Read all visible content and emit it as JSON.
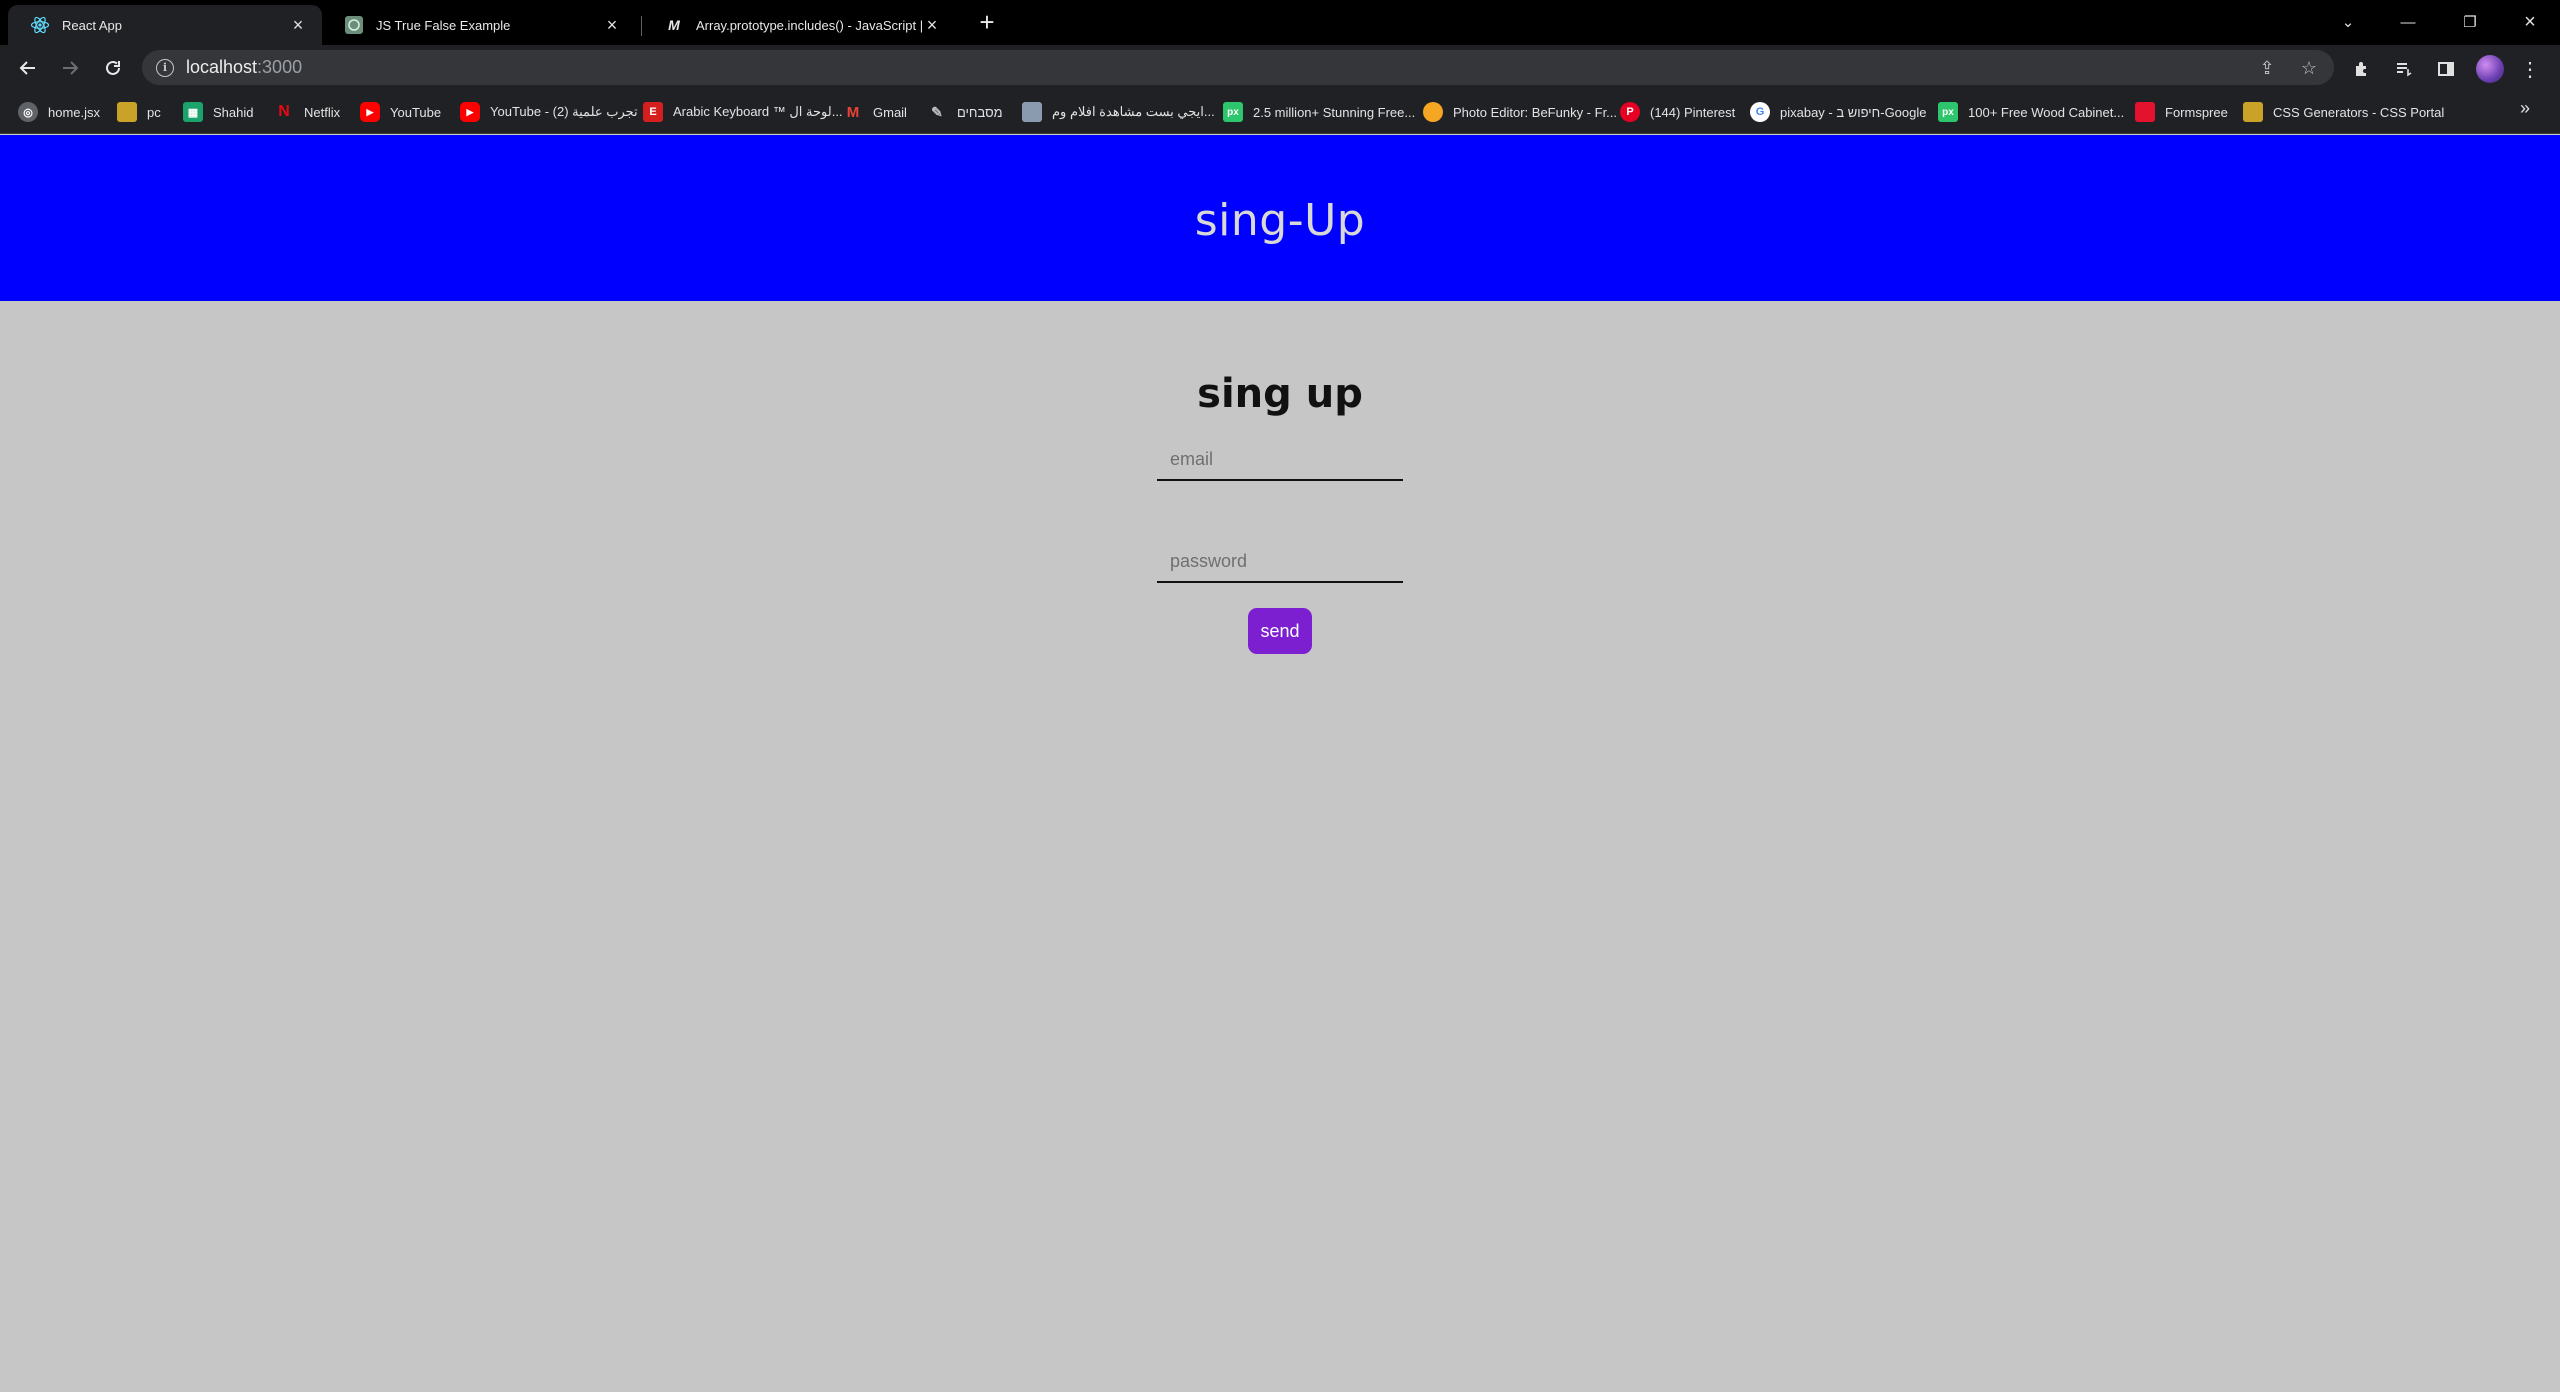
{
  "browser": {
    "tabs": [
      {
        "title": "React App",
        "icon": "react-icon",
        "active": true
      },
      {
        "title": "JS True False Example",
        "icon": "codepen-icon",
        "active": false
      },
      {
        "title": "Array.prototype.includes() - JavaScript | MDN",
        "icon": "mdn-icon",
        "active": false
      }
    ],
    "address": {
      "host": "localhost",
      "port": ":3000"
    },
    "bookmarks": [
      {
        "label": "home.jsx",
        "icon": "globe-icon",
        "color": "#5f6368"
      },
      {
        "label": "pc",
        "icon": "folder-icon",
        "color": "#c9a227"
      },
      {
        "label": "Shahid",
        "icon": "shahid-icon",
        "color": "#1aa36b"
      },
      {
        "label": "Netflix",
        "icon": "netflix-icon",
        "color": "#e50914"
      },
      {
        "label": "YouTube",
        "icon": "youtube-icon",
        "color": "#ff0000"
      },
      {
        "label": "YouTube - تجرب علمية (2)",
        "icon": "youtube-icon",
        "color": "#ff0000"
      },
      {
        "label": "Arabic Keyboard ™ لوحة ال...",
        "icon": "arabic-keyboard-icon",
        "color": "#d41f1f"
      },
      {
        "label": "Gmail",
        "icon": "gmail-icon",
        "color": "#ea4335"
      },
      {
        "label": "מסבחים",
        "icon": "tools-icon",
        "color": "#9aa0a6"
      },
      {
        "label": "ايجي بست مشاهدة افلام وم...",
        "icon": "egybest-icon",
        "color": "#8a9bb0"
      },
      {
        "label": "2.5 million+ Stunning Free...",
        "icon": "pixabay-icon",
        "color": "#2ec66d"
      },
      {
        "label": "Photo Editor: BeFunky - Fr...",
        "icon": "befunky-icon",
        "color": "#f5a623"
      },
      {
        "label": "(144) Pinterest",
        "icon": "pinterest-icon",
        "color": "#e60023"
      },
      {
        "label": "pixabay - חיפוש ב-Google",
        "icon": "google-icon",
        "color": "#ffffff"
      },
      {
        "label": "100+ Free Wood Cabinet...",
        "icon": "pixabay-icon",
        "color": "#2ec66d"
      },
      {
        "label": "Formspree",
        "icon": "formspree-icon",
        "color": "#e5122e"
      },
      {
        "label": "CSS Generators - CSS Portal",
        "icon": "cssportal-icon",
        "color": "#c9a227"
      }
    ]
  },
  "page": {
    "header_title": "sing-Up",
    "form_title": "sing up",
    "email_placeholder": "email",
    "password_placeholder": "password",
    "send_label": "send"
  },
  "colors": {
    "header_bg": "#0000ff",
    "page_bg": "#c6c6c6",
    "button_bg": "#7b1fd0"
  }
}
